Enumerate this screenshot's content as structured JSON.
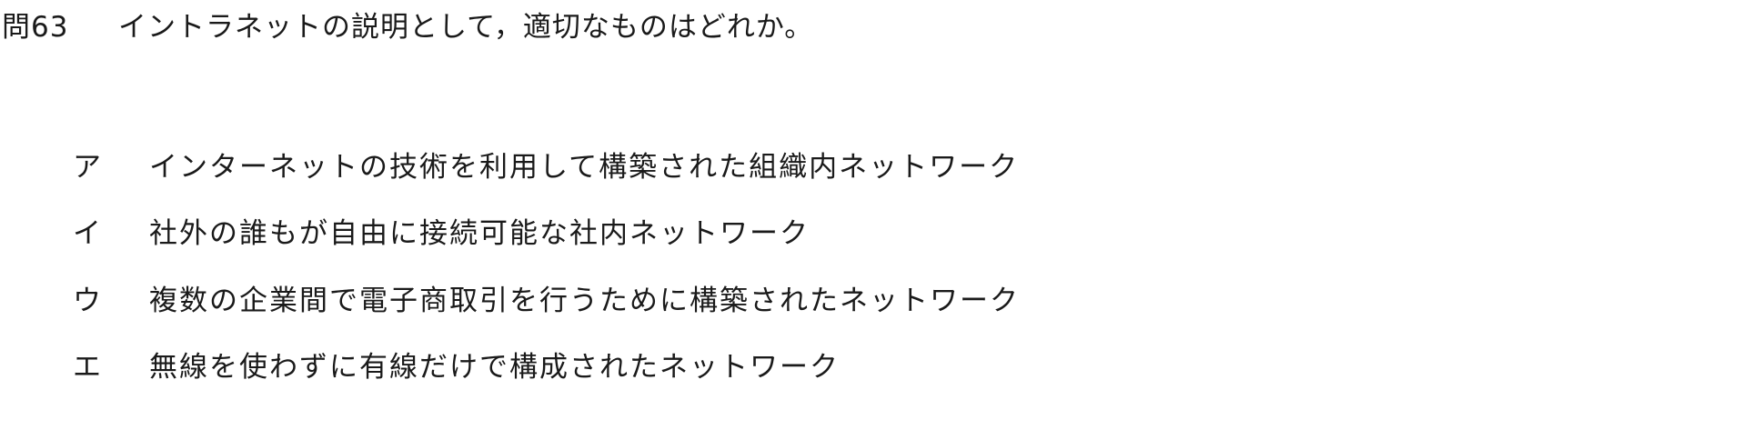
{
  "question": {
    "number": "問63",
    "text": "イントラネットの説明として，適切なものはどれか。"
  },
  "choices": [
    {
      "mark": "ア",
      "text": "インターネットの技術を利用して構築された組織内ネットワーク"
    },
    {
      "mark": "イ",
      "text": "社外の誰もが自由に接続可能な社内ネットワーク"
    },
    {
      "mark": "ウ",
      "text": "複数の企業間で電子商取引を行うために構築されたネットワーク"
    },
    {
      "mark": "エ",
      "text": "無線を使わずに有線だけで構成されたネットワーク"
    }
  ]
}
